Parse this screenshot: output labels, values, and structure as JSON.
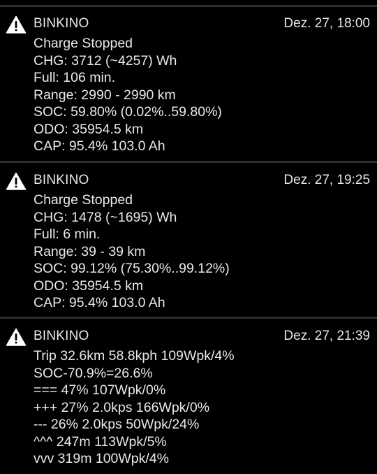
{
  "notifications": [
    {
      "app": "BINKINO",
      "time": "Dez. 27, 18:00",
      "icon": "warning-icon",
      "lines": [
        "Charge Stopped",
        "CHG: 3712 (~4257) Wh",
        "Full: 106 min.",
        "Range: 2990 - 2990 km",
        "SOC: 59.80% (0.02%..59.80%)",
        "ODO: 35954.5 km",
        "CAP: 95.4% 103.0 Ah"
      ]
    },
    {
      "app": "BINKINO",
      "time": "Dez. 27, 19:25",
      "icon": "warning-icon",
      "lines": [
        "Charge Stopped",
        "CHG: 1478 (~1695) Wh",
        "Full: 6 min.",
        "Range: 39 - 39 km",
        "SOC: 99.12% (75.30%..99.12%)",
        "ODO: 35954.5 km",
        "CAP: 95.4% 103.0 Ah"
      ]
    },
    {
      "app": "BINKINO",
      "time": "Dez. 27, 21:39",
      "icon": "warning-icon",
      "lines": [
        "Trip 32.6km 58.8kph 109Wpk/4%",
        "SOC-70.9%=26.6%",
        "=== 47% 107Wpk/0%",
        "+++ 27% 2.0kps 166Wpk/0%",
        "--- 26% 2.0kps 50Wpk/24%",
        "^^^ 247m 113Wpk/5%",
        "vvv 319m 100Wpk/4%"
      ]
    }
  ],
  "colors": {
    "background": "#000000",
    "text": "#e8e8e8",
    "divider": "#2e2e2e",
    "icon": "#ffffff"
  }
}
